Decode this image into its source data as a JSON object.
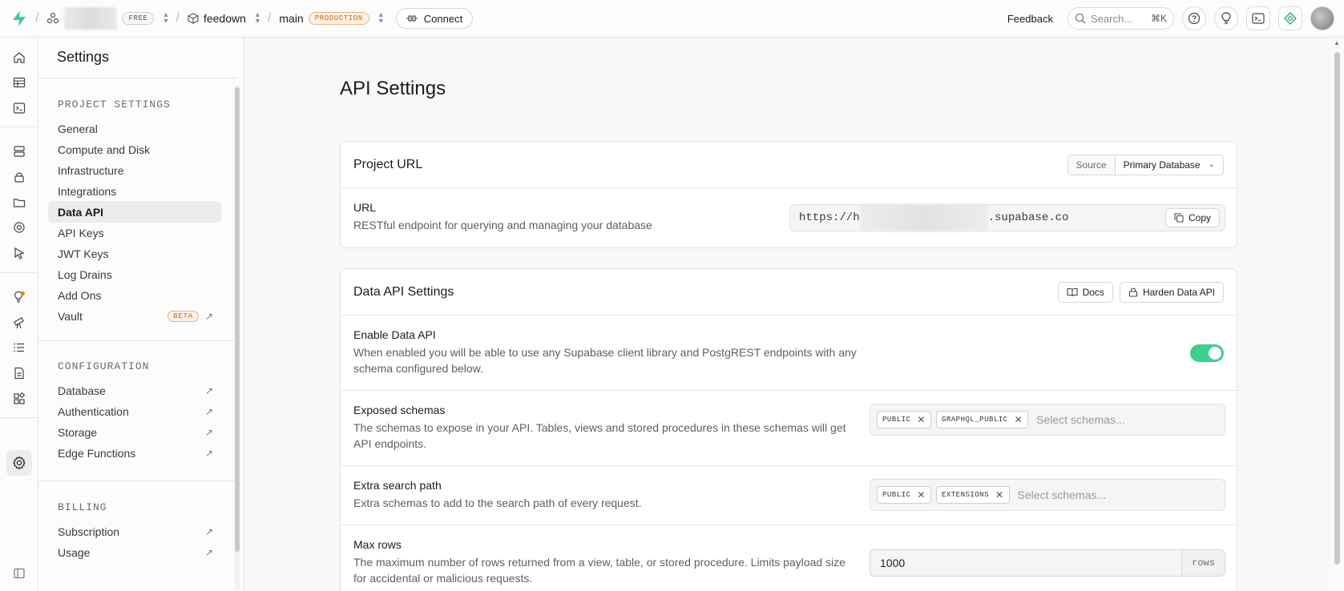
{
  "topbar": {
    "project_plan": "FREE",
    "project_name": "feedown",
    "branch": "main",
    "branch_badge": "PRODUCTION",
    "connect_label": "Connect",
    "feedback_label": "Feedback",
    "search_placeholder": "Search...",
    "search_shortcut": "⌘K"
  },
  "menu": {
    "title": "Settings",
    "sections": [
      {
        "heading": "PROJECT SETTINGS",
        "items": [
          "General",
          "Compute and Disk",
          "Infrastructure",
          "Integrations",
          "Data API",
          "API Keys",
          "JWT Keys",
          "Log Drains",
          "Add Ons",
          "Vault"
        ]
      },
      {
        "heading": "CONFIGURATION",
        "items": [
          "Database",
          "Authentication",
          "Storage",
          "Edge Functions"
        ]
      },
      {
        "heading": "BILLING",
        "items": [
          "Subscription",
          "Usage"
        ]
      }
    ],
    "active_item": "Data API",
    "vault_badge": "BETA"
  },
  "main": {
    "page_title": "API Settings",
    "project_url_card": {
      "title": "Project URL",
      "source_label": "Source",
      "source_value": "Primary Database",
      "url_label": "URL",
      "url_desc": "RESTful endpoint for querying and managing your database",
      "url_prefix": "https://h",
      "url_suffix": ".supabase.co",
      "copy_label": "Copy"
    },
    "data_api_card": {
      "title": "Data API Settings",
      "docs_label": "Docs",
      "harden_label": "Harden Data API",
      "enable": {
        "label": "Enable Data API",
        "desc": "When enabled you will be able to use any Supabase client library and PostgREST endpoints with any schema configured below.",
        "enabled": true
      },
      "exposed": {
        "label": "Exposed schemas",
        "desc": "The schemas to expose in your API. Tables, views and stored procedures in these schemas will get API endpoints.",
        "chips": [
          "PUBLIC",
          "GRAPHQL_PUBLIC"
        ],
        "placeholder": "Select schemas..."
      },
      "extra": {
        "label": "Extra search path",
        "desc": "Extra schemas to add to the search path of every request.",
        "chips": [
          "PUBLIC",
          "EXTENSIONS"
        ],
        "placeholder": "Select schemas..."
      },
      "maxrows": {
        "label": "Max rows",
        "desc": "The maximum number of rows returned from a view, table, or stored procedure. Limits payload size for accidental or malicious requests.",
        "value": "1000",
        "unit": "rows"
      }
    }
  },
  "colors": {
    "accent": "#3ecf8e",
    "warning": "#c26b12"
  }
}
